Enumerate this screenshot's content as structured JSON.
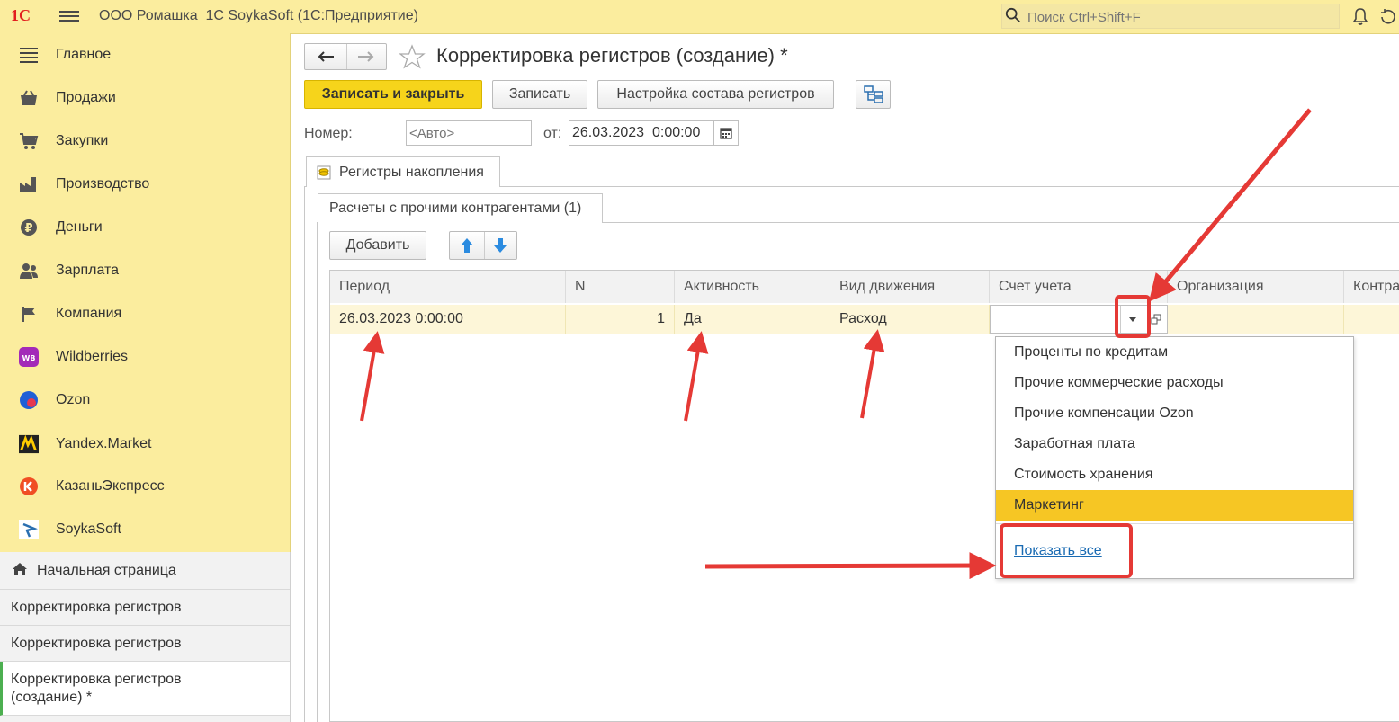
{
  "app": {
    "title": "ООО Ромашка_1С SoykaSoft  (1С:Предприятие)",
    "logo_text": "1С",
    "search_placeholder": "Поиск Ctrl+Shift+F"
  },
  "sidebar": {
    "items": [
      {
        "label": "Главное",
        "icon": "menu-lines-icon"
      },
      {
        "label": "Продажи",
        "icon": "basket-icon"
      },
      {
        "label": "Закупки",
        "icon": "cart-icon"
      },
      {
        "label": "Производство",
        "icon": "factory-icon"
      },
      {
        "label": "Деньги",
        "icon": "ruble-icon"
      },
      {
        "label": "Зарплата",
        "icon": "people-icon"
      },
      {
        "label": "Компания",
        "icon": "flag-icon"
      },
      {
        "label": "Wildberries",
        "icon": "wildberries-logo-icon",
        "badge": "WB"
      },
      {
        "label": "Ozon",
        "icon": "ozon-logo-icon"
      },
      {
        "label": "Yandex.Market",
        "icon": "yandex-market-logo-icon"
      },
      {
        "label": "КазаньЭкспресс",
        "icon": "kazanexpress-logo-icon"
      },
      {
        "label": "SoykaSoft",
        "icon": "soykasoft-logo-icon"
      }
    ]
  },
  "open_windows": {
    "home": "Начальная страница",
    "items": [
      "Корректировка регистров",
      "Корректировка регистров",
      "Корректировка регистров (создание) *"
    ]
  },
  "form": {
    "title": "Корректировка регистров (создание) *",
    "buttons": {
      "save_close": "Записать и закрыть",
      "save": "Записать",
      "registers_setup": "Настройка состава регистров"
    },
    "number_label": "Номер:",
    "number_placeholder": "<Авто>",
    "date_label": "от:",
    "date_value": "26.03.2023  0:00:00",
    "outer_tab": "Регистры накопления",
    "inner_tab": "Расчеты с прочими контрагентами (1)",
    "add_button": "Добавить"
  },
  "grid": {
    "columns": [
      "Период",
      "N",
      "Активность",
      "Вид движения",
      "Счет учета",
      "Организация",
      "Контра"
    ],
    "row": {
      "period": "26.03.2023 0:00:00",
      "n": "1",
      "active": "Да",
      "movement": "Расход",
      "account": "",
      "org": "",
      "contra": ""
    }
  },
  "dropdown": {
    "items": [
      "Проценты по кредитам",
      "Прочие коммерческие расходы",
      "Прочие компенсации Ozon",
      "Заработная плата",
      "Стоимость хранения",
      "Маркетинг"
    ],
    "selected_index": 5,
    "show_all": "Показать все"
  },
  "colors": {
    "panel_bg": "#fbed9e",
    "primary_button": "#f6d41b",
    "selected_row": "#fdf6d8",
    "annotation": "#e53935"
  }
}
